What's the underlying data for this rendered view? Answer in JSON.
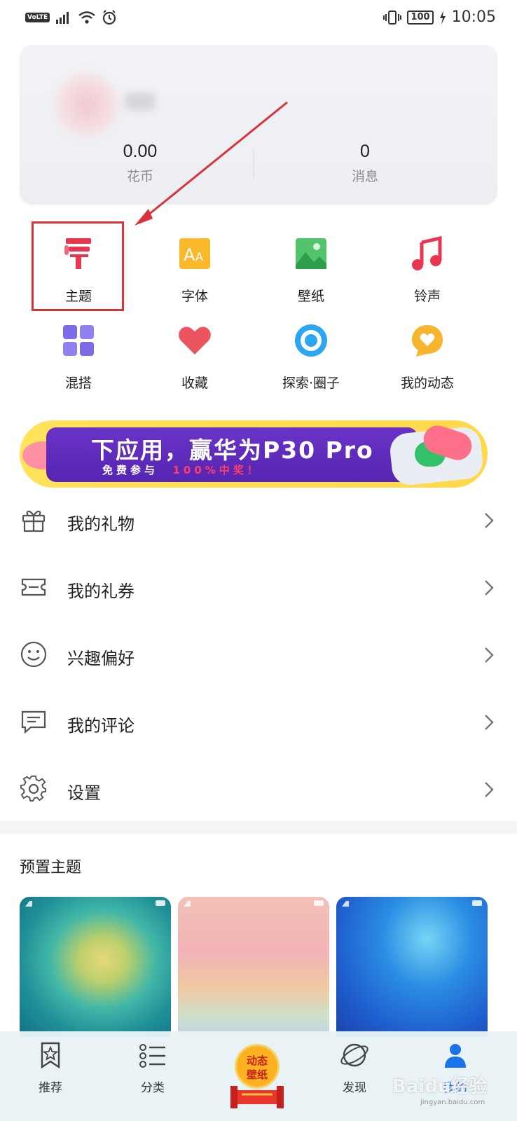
{
  "status_bar": {
    "volte": "VoLTE",
    "battery": "100",
    "time": "10:05"
  },
  "profile": {
    "coins_value": "0.00",
    "coins_label": "花币",
    "messages_value": "0",
    "messages_label": "消息"
  },
  "grid": {
    "items": [
      {
        "label": "主题",
        "icon": "theme-brush-icon"
      },
      {
        "label": "字体",
        "icon": "font-icon"
      },
      {
        "label": "壁纸",
        "icon": "wallpaper-icon"
      },
      {
        "label": "铃声",
        "icon": "ringtone-icon"
      },
      {
        "label": "混搭",
        "icon": "mix-icon"
      },
      {
        "label": "收藏",
        "icon": "favorite-heart-icon"
      },
      {
        "label": "探索·圈子",
        "icon": "explore-circle-icon"
      },
      {
        "label": "我的动态",
        "icon": "my-activity-icon"
      }
    ]
  },
  "banner": {
    "title": "下应用，赢华为P30 Pro",
    "subtitle_prefix": "免费参与",
    "subtitle_highlight": "100%中奖！"
  },
  "menu": {
    "items": [
      {
        "label": "我的礼物",
        "icon": "gift-icon"
      },
      {
        "label": "我的礼券",
        "icon": "coupon-icon"
      },
      {
        "label": "兴趣偏好",
        "icon": "smile-icon"
      },
      {
        "label": "我的评论",
        "icon": "comment-icon"
      },
      {
        "label": "设置",
        "icon": "settings-gear-icon"
      }
    ]
  },
  "preset_themes": {
    "title": "预置主题"
  },
  "bottom_nav": {
    "recommend": "推荐",
    "category": "分类",
    "center_badge_line1": "动态",
    "center_badge_line2": "壁纸",
    "discover": "发现",
    "mine": "我的"
  },
  "watermark": {
    "brand": "Baidu经验",
    "url": "jingyan.baidu.com"
  },
  "colors": {
    "theme_red": "#e8364f",
    "highlight_red": "#d9323a",
    "active_blue": "#1a73e8"
  }
}
